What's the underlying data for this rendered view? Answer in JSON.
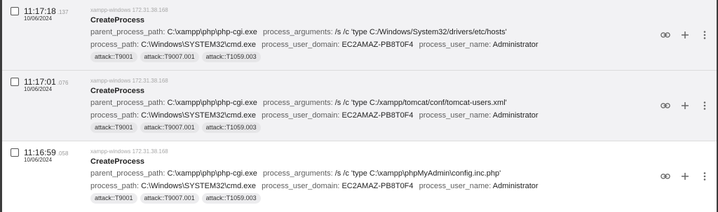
{
  "events": [
    {
      "time": "11:17:18",
      "ms": ".137",
      "date": "10/06/2024",
      "host": "xampp-windows 172.31.38.168",
      "name": "CreateProcess",
      "parent_process_path_key": "parent_process_path:",
      "parent_process_path": "C:\\xampp\\php\\php-cgi.exe",
      "process_arguments_key": "process_arguments:",
      "process_arguments": "/s /c 'type C:/Windows/System32/drivers/etc/hosts'",
      "process_path_key": "process_path:",
      "process_path": "C:\\Windows\\SYSTEM32\\cmd.exe",
      "process_user_domain_key": "process_user_domain:",
      "process_user_domain": "EC2AMAZ-PB8T0F4",
      "process_user_name_key": "process_user_name:",
      "process_user_name": "Administrator",
      "tags": [
        "attack::T9001",
        "attack::T9007.001",
        "attack::T1059.003"
      ]
    },
    {
      "time": "11:17:01",
      "ms": ".076",
      "date": "10/06/2024",
      "host": "xampp-windows 172.31.38.168",
      "name": "CreateProcess",
      "parent_process_path_key": "parent_process_path:",
      "parent_process_path": "C:\\xampp\\php\\php-cgi.exe",
      "process_arguments_key": "process_arguments:",
      "process_arguments": "/s /c 'type C:/xampp/tomcat/conf/tomcat-users.xml'",
      "process_path_key": "process_path:",
      "process_path": "C:\\Windows\\SYSTEM32\\cmd.exe",
      "process_user_domain_key": "process_user_domain:",
      "process_user_domain": "EC2AMAZ-PB8T0F4",
      "process_user_name_key": "process_user_name:",
      "process_user_name": "Administrator",
      "tags": [
        "attack::T9001",
        "attack::T9007.001",
        "attack::T1059.003"
      ]
    },
    {
      "time": "11:16:59",
      "ms": ".058",
      "date": "10/06/2024",
      "host": "xampp-windows 172.31.38.168",
      "name": "CreateProcess",
      "parent_process_path_key": "parent_process_path:",
      "parent_process_path": "C:\\xampp\\php\\php-cgi.exe",
      "process_arguments_key": "process_arguments:",
      "process_arguments": "/s /c 'type C:\\xampp\\phpMyAdmin\\config.inc.php'",
      "process_path_key": "process_path:",
      "process_path": "C:\\Windows\\SYSTEM32\\cmd.exe",
      "process_user_domain_key": "process_user_domain:",
      "process_user_domain": "EC2AMAZ-PB8T0F4",
      "process_user_name_key": "process_user_name:",
      "process_user_name": "Administrator",
      "tags": [
        "attack::T9001",
        "attack::T9007.001",
        "attack::T1059.003"
      ]
    }
  ],
  "icons": {
    "link": "link-icon",
    "add": "plus-icon",
    "more": "more-vert-icon"
  },
  "colors": {
    "row_bg": "#f2f2f4",
    "tag_bg": "#e6e6e8",
    "host_text": "#a8a8a8"
  }
}
